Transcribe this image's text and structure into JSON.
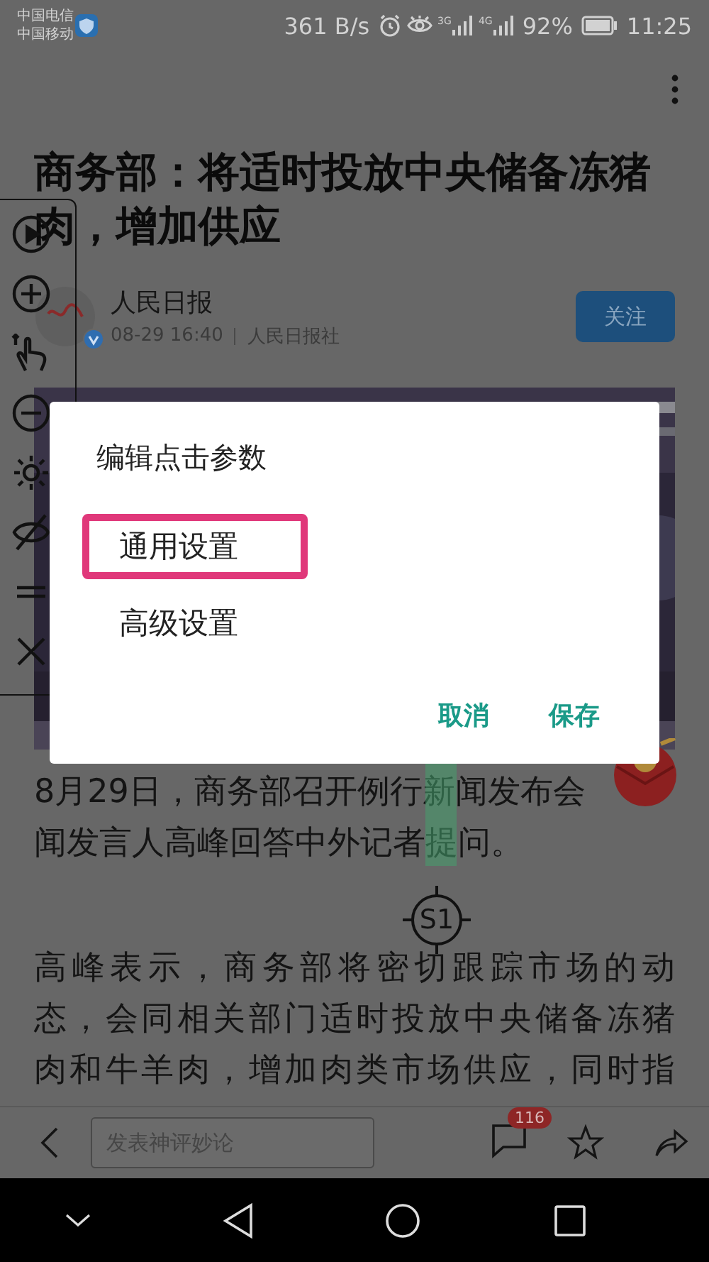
{
  "status_bar": {
    "carriers": [
      "中国电信",
      "中国移动"
    ],
    "speed": "361 B/s",
    "net_1": "3G",
    "net_2": "4G",
    "battery": "92%",
    "time": "11:25"
  },
  "article": {
    "title": "商务部：将适时投放中央储备冻猪肉，增加供应",
    "source": "人民日报",
    "date": "08-29 16:40",
    "publisher": "人民日报社",
    "follow_button": "关注",
    "paragraphs": [
      {
        "lines": [
          "8月29日，商务部召开例行新闻发布会",
          "闻发言人高峰回答中外记者提问。"
        ],
        "justified": false
      },
      {
        "lines": [
          "高峰表示，商务部将密切跟踪市场的动",
          "态，会同相关部门适时投放中央储备冻猪",
          "肉和牛羊肉，增加肉类市场供应，同时指"
        ],
        "justified": true
      }
    ]
  },
  "dialog": {
    "title": "编辑点击参数",
    "options": [
      {
        "label": "通用设置",
        "selected": true
      },
      {
        "label": "高级设置",
        "selected": false
      }
    ],
    "buttons": [
      "取消",
      "保存"
    ]
  },
  "marker": {
    "label": "S1"
  },
  "comment_bar": {
    "placeholder": "发表神评妙论",
    "comment_count": "116"
  }
}
